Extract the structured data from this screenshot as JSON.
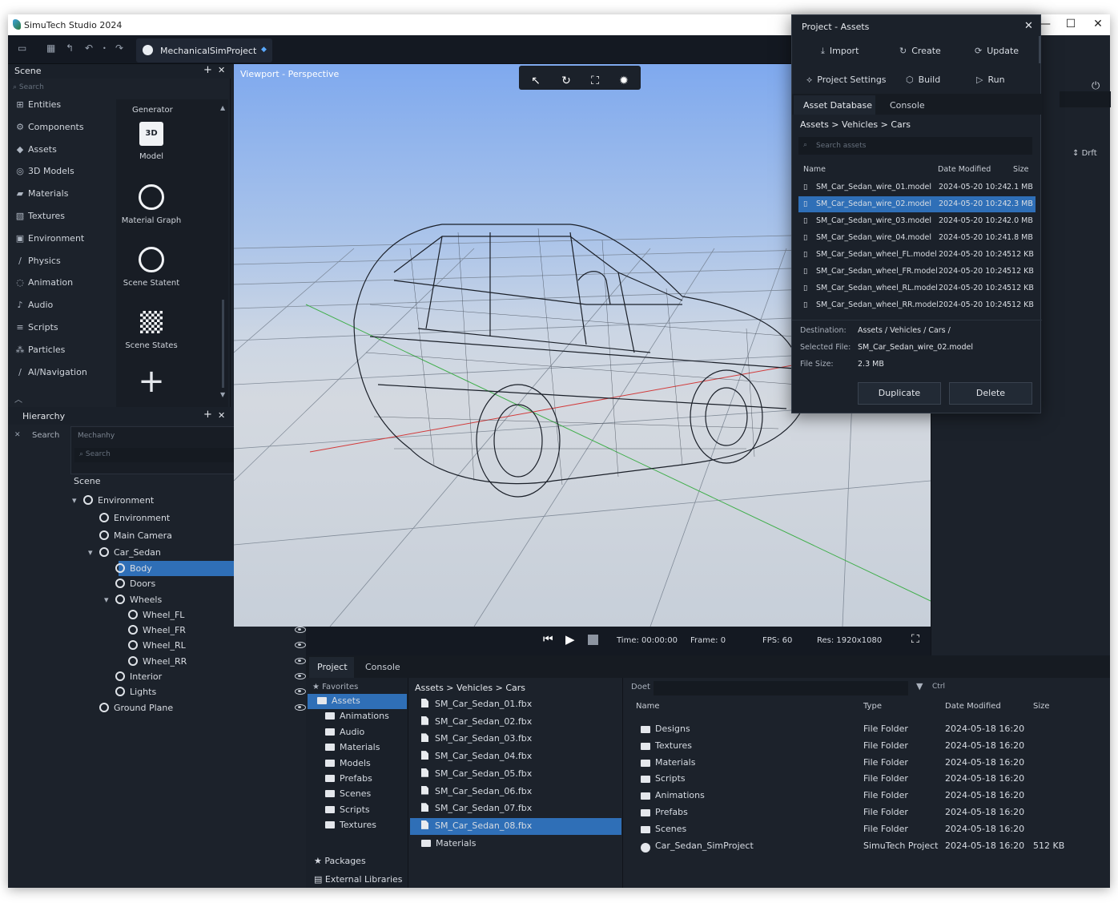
{
  "titlebar": {
    "title": "SimuTech Studio 2024",
    "minimize": "—",
    "maximize": "☐",
    "close": "✕"
  },
  "toolbar": {
    "project_tab": "MechanicalSimProject"
  },
  "scene_panel": {
    "title": "Scene",
    "search_placeholder": "Search",
    "items": [
      {
        "icon": "⊞",
        "label": "Entities"
      },
      {
        "icon": "⚙",
        "label": "Components"
      },
      {
        "icon": "◆",
        "label": "Assets"
      },
      {
        "icon": "◎",
        "label": "3D Models"
      },
      {
        "icon": "▰",
        "label": "Materials"
      },
      {
        "icon": "▧",
        "label": "Textures"
      },
      {
        "icon": "▣",
        "label": "Environment"
      },
      {
        "icon": "∕",
        "label": "Physics"
      },
      {
        "icon": "◌",
        "label": "Animation"
      },
      {
        "icon": "♪",
        "label": "Audio"
      },
      {
        "icon": "≡",
        "label": "Scripts"
      },
      {
        "icon": "⁂",
        "label": "Particles"
      },
      {
        "icon": "∕",
        "label": "AI/Navigation"
      }
    ],
    "generator_title": "Generator",
    "generator_items": [
      {
        "label": "Model"
      },
      {
        "label": "Material Graph"
      },
      {
        "label": "Scene Statent"
      },
      {
        "label": "Scene States"
      },
      {
        "label": ""
      }
    ]
  },
  "hierarchy": {
    "title": "Hierarchy",
    "search_label": "Search",
    "subpanel_title": "Mechanhy",
    "sub_search": "Search",
    "root": "Scene",
    "nodes": [
      {
        "label": "Environment",
        "indent": 0
      },
      {
        "label": "Environment",
        "indent": 1
      },
      {
        "label": "Main Camera",
        "indent": 1
      },
      {
        "label": "Car_Sedan",
        "indent": 1
      },
      {
        "label": "Body",
        "indent": 2,
        "selected": true
      },
      {
        "label": "Doors",
        "indent": 2
      },
      {
        "label": "Wheels",
        "indent": 2
      },
      {
        "label": "Wheel_FL",
        "indent": 3
      },
      {
        "label": "Wheel_FR",
        "indent": 3
      },
      {
        "label": "Wheel_RL",
        "indent": 3
      },
      {
        "label": "Wheel_RR",
        "indent": 3
      },
      {
        "label": "Interior",
        "indent": 2
      },
      {
        "label": "Lights",
        "indent": 2
      },
      {
        "label": "Ground Plane",
        "indent": 1
      }
    ]
  },
  "viewport": {
    "label": "Viewport - Perspective",
    "status": {
      "time": "Time: 00:00:00",
      "frame": "Frame: 0",
      "fps": "FPS: 60",
      "res": "Res: 1920x1080"
    }
  },
  "right_panel": {
    "drift": "Drft"
  },
  "assets_popup": {
    "title": "Project - Assets",
    "actions": [
      {
        "icon": "⤓",
        "label": "Import"
      },
      {
        "icon": "↻",
        "label": "Create"
      },
      {
        "icon": "⟳",
        "label": "Update"
      },
      {
        "icon": "⟡",
        "label": "Project Settings"
      },
      {
        "icon": "⬡",
        "label": "Build"
      },
      {
        "icon": "▷",
        "label": "Run"
      }
    ],
    "tabs": [
      "Asset Database",
      "Console"
    ],
    "breadcrumb": [
      "Assets",
      "Vehicles",
      "Cars"
    ],
    "search_placeholder": "Search assets",
    "columns": [
      "Name",
      "Date Modified",
      "Size"
    ],
    "files": [
      {
        "name": "SM_Car_Sedan_wire_01.model",
        "date": "2024-05-20 10:24",
        "size": "2.1 MB"
      },
      {
        "name": "SM_Car_Sedan_wire_02.model",
        "date": "2024-05-20 10:24",
        "size": "2.3 MB",
        "selected": true
      },
      {
        "name": "SM_Car_Sedan_wire_03.model",
        "date": "2024-05-20 10:24",
        "size": "2.0 MB"
      },
      {
        "name": "SM_Car_Sedan_wire_04.model",
        "date": "2024-05-20 10:24",
        "size": "1.8 MB"
      },
      {
        "name": "SM_Car_Sedan_wheel_FL.model",
        "date": "2024-05-20 10:24",
        "size": "512 KB"
      },
      {
        "name": "SM_Car_Sedan_wheel_FR.model",
        "date": "2024-05-20 10:24",
        "size": "512 KB"
      },
      {
        "name": "SM_Car_Sedan_wheel_RL.model",
        "date": "2024-05-20 10:24",
        "size": "512 KB"
      },
      {
        "name": "SM_Car_Sedan_wheel_RR.model",
        "date": "2024-05-20 10:24",
        "size": "512 KB"
      }
    ],
    "details": [
      {
        "key": "Destination:",
        "value": "Assets / Vehicles / Cars /"
      },
      {
        "key": "Selected File:",
        "value": "SM_Car_Sedan_wire_02.model"
      },
      {
        "key": "File Size:",
        "value": "2.3 MB"
      }
    ],
    "duplicate": "Duplicate",
    "delete": "Delete"
  },
  "project_panel": {
    "tabs": [
      "Project",
      "Console"
    ],
    "favorites": "Favorites",
    "folders": [
      "Assets",
      "Animations",
      "Audio",
      "Materials",
      "Models",
      "Prefabs",
      "Scenes",
      "Scripts",
      "Textures"
    ],
    "packages": "Packages",
    "external": "External Libraries",
    "breadcrumb": [
      "Assets",
      "Vehicles",
      "Cars"
    ],
    "files": [
      "SM_Car_Sedan_01.fbx",
      "SM_Car_Sedan_02.fbx",
      "SM_Car_Sedan_03.fbx",
      "SM_Car_Sedan_04.fbx",
      "SM_Car_Sedan_05.fbx",
      "SM_Car_Sedan_06.fbx",
      "SM_Car_Sedan_07.fbx",
      "SM_Car_Sedan_08.fbx",
      "Materials"
    ],
    "selected_file": "SM_Car_Sedan_08.fbx",
    "filter_label": "Doet",
    "filter_right": "Ctrl",
    "columns": [
      "Name",
      "Type",
      "Date Modified",
      "Size"
    ],
    "rows": [
      {
        "name": "Designs",
        "type": "File Folder",
        "date": "2024-05-18 16:20",
        "size": ""
      },
      {
        "name": "Textures",
        "type": "File Folder",
        "date": "2024-05-18 16:20",
        "size": ""
      },
      {
        "name": "Materials",
        "type": "File Folder",
        "date": "2024-05-18 16:20",
        "size": ""
      },
      {
        "name": "Scripts",
        "type": "File Folder",
        "date": "2024-05-18 16:20",
        "size": ""
      },
      {
        "name": "Animations",
        "type": "File Folder",
        "date": "2024-05-18 16:20",
        "size": ""
      },
      {
        "name": "Prefabs",
        "type": "File Folder",
        "date": "2024-05-18 16:20",
        "size": ""
      },
      {
        "name": "Scenes",
        "type": "File Folder",
        "date": "2024-05-18 16:20",
        "size": ""
      },
      {
        "name": "Car_Sedan_SimProject",
        "type": "SimuTech Project",
        "date": "2024-05-18 16:20",
        "size": "512 KB"
      }
    ]
  },
  "colors": {
    "accent": "#2f6fb7",
    "panel": "#1c222b",
    "toolbar": "#141922",
    "viewport_sky": "#7fa9ee"
  }
}
